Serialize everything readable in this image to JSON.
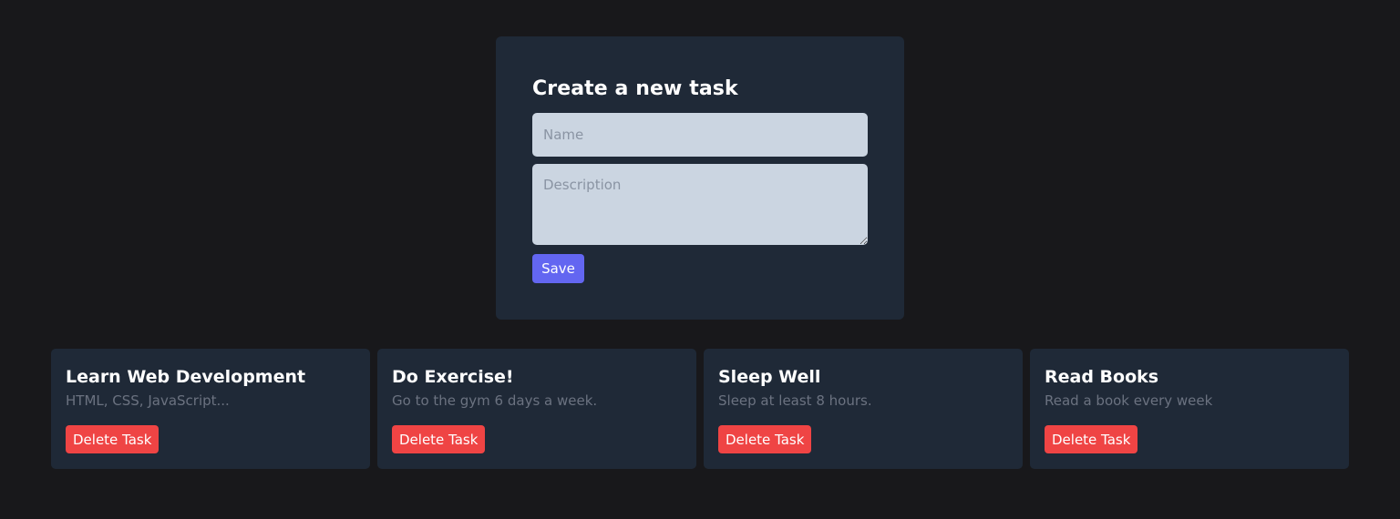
{
  "form": {
    "title": "Create a new task",
    "name_placeholder": "Name",
    "name_value": "",
    "description_placeholder": "Description",
    "description_value": "",
    "save_label": "Save"
  },
  "tasks": [
    {
      "title": "Learn Web Development",
      "description": "HTML, CSS, JavaScript...",
      "delete_label": "Delete Task"
    },
    {
      "title": "Do Exercise!",
      "description": "Go to the gym 6 days a week.",
      "delete_label": "Delete Task"
    },
    {
      "title": "Sleep Well",
      "description": "Sleep at least 8 hours.",
      "delete_label": "Delete Task"
    },
    {
      "title": "Read Books",
      "description": "Read a book every week",
      "delete_label": "Delete Task"
    }
  ],
  "colors": {
    "page_background": "#18181b",
    "card_background": "#1f2937",
    "input_background": "#cbd5e1",
    "save_button": "#6366f1",
    "delete_button": "#ef4444",
    "muted_text": "#6b7280"
  }
}
